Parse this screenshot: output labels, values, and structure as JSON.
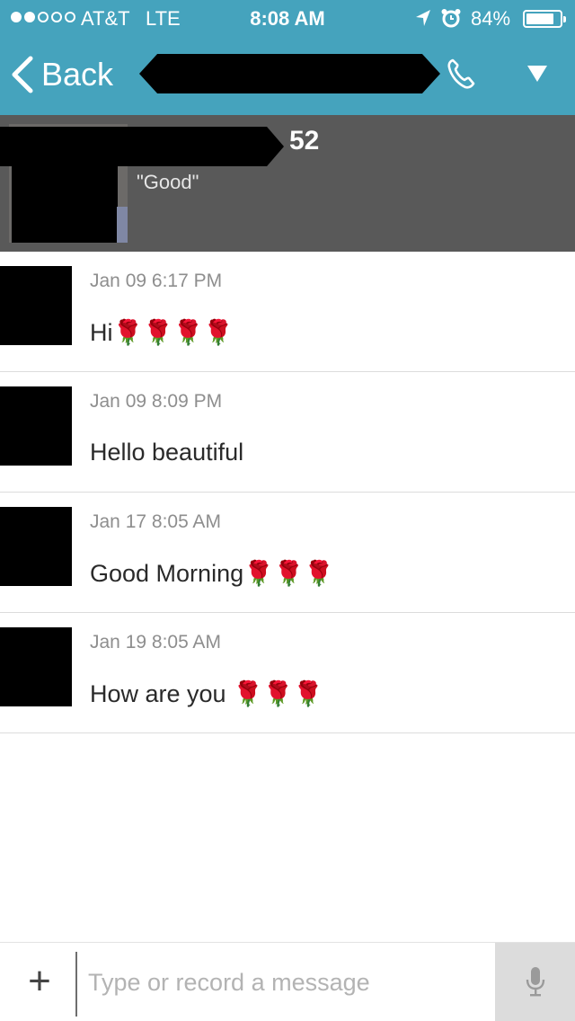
{
  "status_bar": {
    "carrier": "AT&T",
    "network": "LTE",
    "time": "8:08 AM",
    "battery": "84%",
    "signal_bars_filled": 2,
    "signal_bars_total": 5,
    "battery_level": 0.84
  },
  "nav": {
    "back_label": "Back",
    "title": "",
    "call_icon": "phone-icon",
    "menu_icon": "triangle-down-icon"
  },
  "profile": {
    "name": "",
    "age": "52",
    "status": "\"Good\""
  },
  "messages": [
    {
      "time": "Jan 09 6:17 PM",
      "text": "Hi",
      "roses": "🌹🌹🌹🌹"
    },
    {
      "time": "Jan 09 8:09 PM",
      "text": "Hello beautiful",
      "roses": ""
    },
    {
      "time": "Jan 17 8:05 AM",
      "text": "Good Morning",
      "roses": "🌹🌹🌹"
    },
    {
      "time": "Jan 19 8:05 AM",
      "text": "How are you ",
      "roses": "🌹🌹🌹"
    }
  ],
  "composer": {
    "add_label": "+",
    "placeholder": "Type or record a message",
    "mic_icon": "microphone-icon"
  },
  "colors": {
    "header": "#45a3bd",
    "profile_banner": "#595959",
    "mic_button_bg": "#dcdcdc"
  }
}
